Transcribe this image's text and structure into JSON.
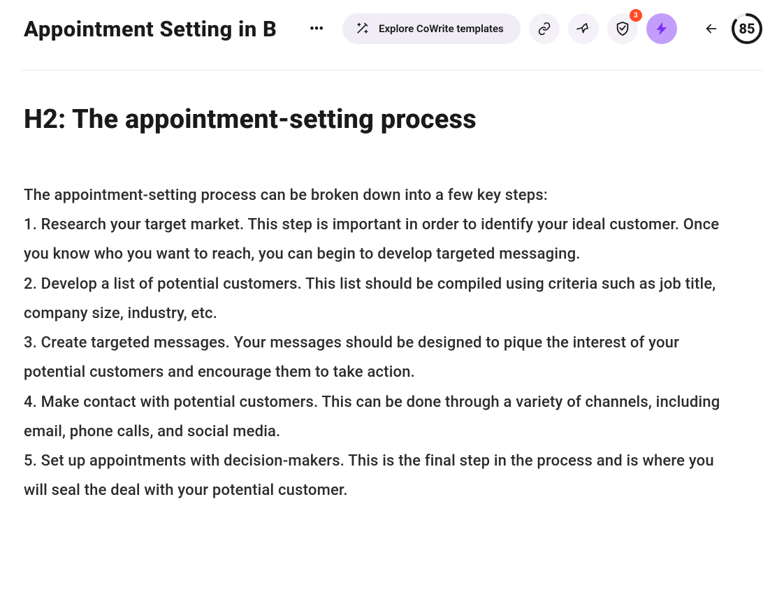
{
  "header": {
    "doc_title": "Appointment Setting in B",
    "cowrite_label": "Explore CoWrite templates",
    "shield_badge": "3",
    "score": "85"
  },
  "document": {
    "heading": "H2: The appointment-setting process",
    "intro": "The appointment-setting process can be broken down into a few key steps:",
    "step1": "1. Research your target market. This step is important in order to identify your ideal customer. Once you know who you want to reach, you can begin to develop targeted messaging.",
    "step2": "2. Develop a list of potential customers. This list should be compiled using criteria such as job title, company size, industry, etc.",
    "step3": "3. Create targeted messages. Your messages should be designed to pique the interest of your potential customers and encourage them to take action.",
    "step4": "4. Make contact with potential customers. This can be done through a variety of channels, including email, phone calls, and social media.",
    "step5": "5. Set up appointments with decision-makers. This is the final step in the process and is where you will seal the deal with your potential customer."
  }
}
